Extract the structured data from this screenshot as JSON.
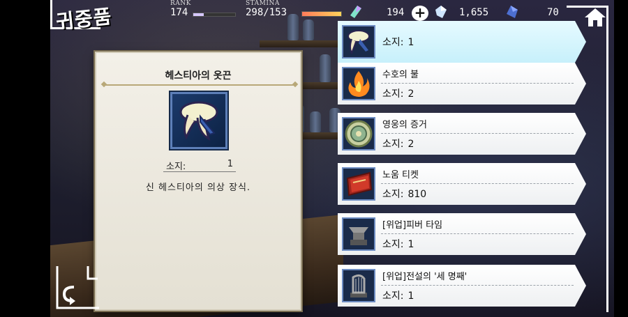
{
  "screen_title": "귀중품",
  "status": {
    "rank_label": "RANK",
    "rank_value": "174",
    "rank_progress": 0.25,
    "stamina_label": "STAMINA",
    "stamina_value": "298/153",
    "stamina_progress": 1.0,
    "crystals": "194",
    "secondary_currency": "1,655",
    "tertiary_currency": "70"
  },
  "detail": {
    "name": "헤스티아의 옷끈",
    "owned_label": "소지:",
    "owned_value": "1",
    "description": "신 헤스티아의 의상 장식.",
    "icon": "ribbon-icon"
  },
  "items": [
    {
      "name": "",
      "owned_label": "소지:",
      "owned": "1",
      "icon": "ribbon-icon",
      "selected": true
    },
    {
      "name": "수호의 불",
      "owned_label": "소지:",
      "owned": "2",
      "icon": "flame-icon",
      "selected": false
    },
    {
      "name": "영웅의 증거",
      "owned_label": "소지:",
      "owned": "2",
      "icon": "medal-icon",
      "selected": false
    },
    {
      "name": "노움 티켓",
      "owned_label": "소지:",
      "owned": "810",
      "icon": "ticket-icon",
      "selected": false
    },
    {
      "name": "[위업]피버 타임",
      "owned_label": "소지:",
      "owned": "1",
      "icon": "anvil-statue-icon",
      "selected": false
    },
    {
      "name": "[위업]전설의 '세 명째'",
      "owned_label": "소지:",
      "owned": "1",
      "icon": "harp-statue-icon",
      "selected": false
    }
  ],
  "colors": {
    "selected_item": "#c7f0fb",
    "icon_frame": "#1a2b4a",
    "accent_gold": "#b8a878"
  }
}
